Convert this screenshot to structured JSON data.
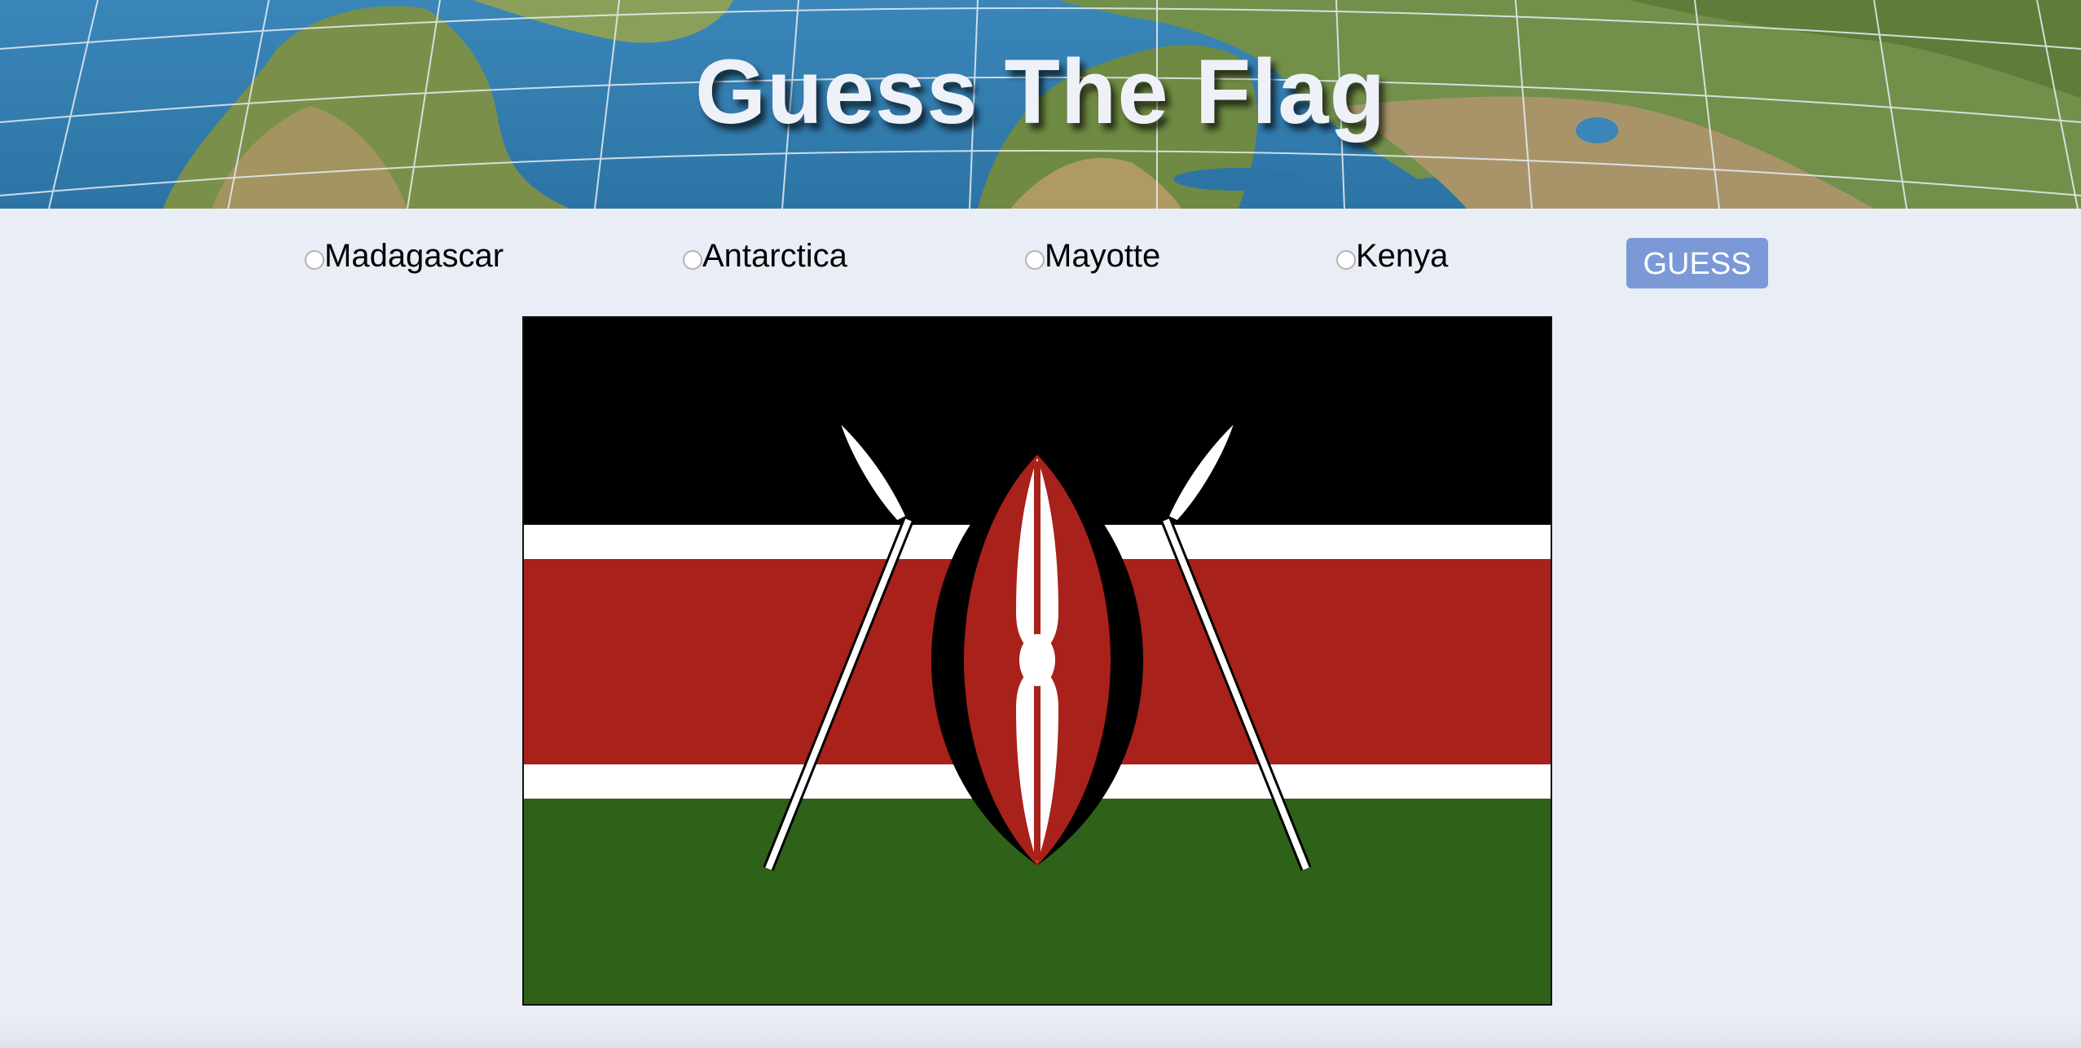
{
  "header": {
    "title": "Guess The Flag"
  },
  "options": [
    {
      "label": "Madagascar",
      "selected": false
    },
    {
      "label": "Antarctica",
      "selected": false
    },
    {
      "label": "Mayotte",
      "selected": false
    },
    {
      "label": "Kenya",
      "selected": false
    }
  ],
  "guess_button": {
    "label": "GUESS"
  },
  "colors": {
    "page_background": "#e9edf5",
    "button": "#7b99d6",
    "flag_black": "#000000",
    "flag_red": "#a8211a",
    "flag_green": "#2e6219",
    "flag_white": "#ffffff"
  }
}
